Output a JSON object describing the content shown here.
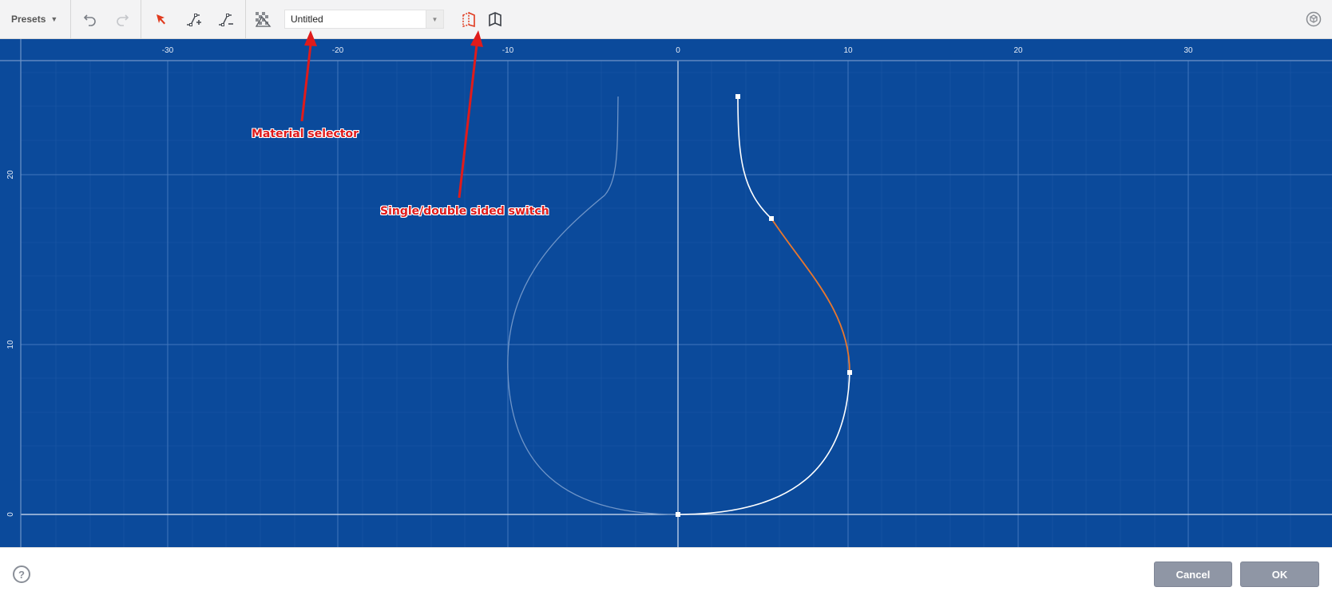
{
  "toolbar": {
    "presets_label": "Presets",
    "material_value": "Untitled",
    "tools": [
      "undo-icon",
      "redo-icon",
      "select-arrow-icon",
      "add-point-icon",
      "delete-point-icon",
      "material-checker-icon",
      "single-sided-icon",
      "double-sided-icon",
      "view-cube-icon"
    ]
  },
  "canvas": {
    "background": "#0b4a9b",
    "x_ticks": [
      "-30",
      "-20",
      "-10",
      "0",
      "10",
      "20",
      "30"
    ],
    "y_ticks": [
      "20",
      "10",
      "0"
    ],
    "curve_color": "#ffffff",
    "selected_segment_color": "#e8772e",
    "mirror_color": "#6f95c8"
  },
  "annotations": {
    "material_selector": "Material selector",
    "sided_switch": "Single/double sided switch",
    "color": "#e01b1b"
  },
  "footer": {
    "help_label": "?",
    "cancel_label": "Cancel",
    "ok_label": "OK"
  }
}
